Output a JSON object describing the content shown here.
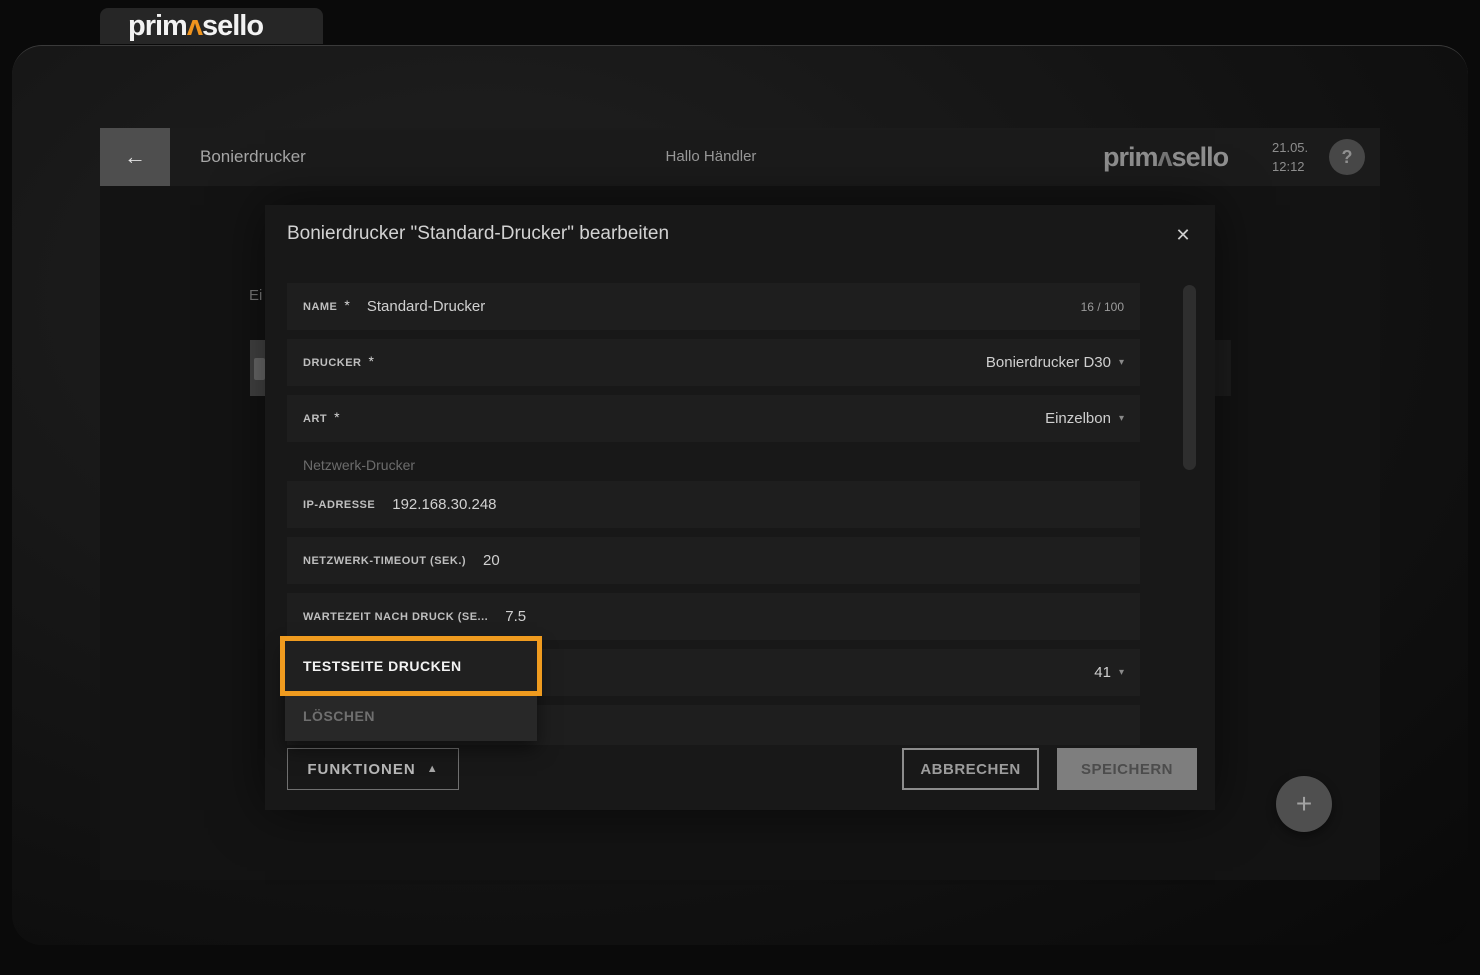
{
  "brand": {
    "prefix": "prim",
    "mark": "ʌ",
    "suffix": "sello",
    "accent_color": "#f0941e"
  },
  "header": {
    "back_icon": "←",
    "title": "Bonierdrucker",
    "greeting": "Hallo Händler",
    "date": "21.05.",
    "time": "12:12",
    "help_icon": "?"
  },
  "page_background": {
    "partial_section_label": "Ei"
  },
  "modal": {
    "title": "Bonierdrucker \"Standard-Drucker\" bearbeiten",
    "close_icon": "✕",
    "name_field": {
      "label": "NAME",
      "required_mark": "*",
      "value": "Standard-Drucker",
      "counter": "16 / 100"
    },
    "drucker_field": {
      "label": "DRUCKER",
      "required_mark": "*",
      "value": "Bonierdrucker D30",
      "caret": "▾"
    },
    "art_field": {
      "label": "ART",
      "required_mark": "*",
      "value": "Einzelbon",
      "caret": "▾"
    },
    "section_label": "Netzwerk-Drucker",
    "ip_field": {
      "label": "IP-ADRESSE",
      "value": "192.168.30.248"
    },
    "timeout_field": {
      "label": "NETZWERK-TIMEOUT (SEK.)",
      "value": "20"
    },
    "wait_field": {
      "label": "WARTEZEIT NACH DRUCK (SE...",
      "value": "7.5"
    },
    "covered_field": {
      "value": "41",
      "caret": "▾"
    },
    "menu": {
      "highlight_border_color": "#ef9b1f",
      "test_item": "TESTSEITE DRUCKEN",
      "delete_item": "LÖSCHEN"
    },
    "functions_button": {
      "label": "FUNKTIONEN",
      "caret": "▲"
    },
    "cancel_button": "ABBRECHEN",
    "save_button": "SPEICHERN"
  },
  "fab": {
    "plus_icon": "+"
  }
}
